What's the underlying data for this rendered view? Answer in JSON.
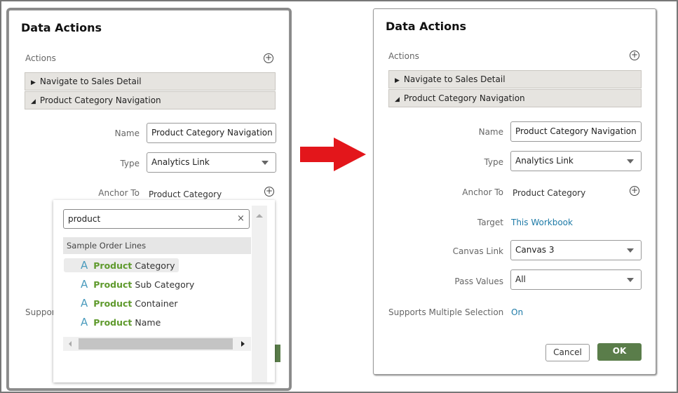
{
  "left": {
    "title": "Data Actions",
    "actions_label": "Actions",
    "accordion": [
      {
        "label": "Navigate to Sales Detail",
        "expanded": false
      },
      {
        "label": "Product Category Navigation",
        "expanded": true
      }
    ],
    "name_label": "Name",
    "name_value": "Product Category Navigation",
    "type_label": "Type",
    "type_value": "Analytics Link",
    "anchor_label": "Anchor To",
    "anchor_value": "Product Category",
    "supports_label_partial": "Suppor",
    "popup": {
      "search_value": "product",
      "group": "Sample Order Lines",
      "items": [
        {
          "match": "Product",
          "rest": " Category",
          "selected": true
        },
        {
          "match": "Product",
          "rest": " Sub Category"
        },
        {
          "match": "Product",
          "rest": " Container"
        },
        {
          "match": "Product",
          "rest": " Name"
        }
      ]
    }
  },
  "right": {
    "title": "Data Actions",
    "actions_label": "Actions",
    "accordion": [
      {
        "label": "Navigate to Sales Detail",
        "expanded": false
      },
      {
        "label": "Product Category Navigation",
        "expanded": true
      }
    ],
    "name_label": "Name",
    "name_value": "Product Category Navigation",
    "type_label": "Type",
    "type_value": "Analytics Link",
    "anchor_label": "Anchor To",
    "anchor_value": "Product Category",
    "target_label": "Target",
    "target_value": "This Workbook",
    "canvas_label": "Canvas Link",
    "canvas_value": "Canvas 3",
    "pass_label": "Pass Values",
    "pass_value": "All",
    "supports_label": "Supports Multiple Selection",
    "supports_value": "On",
    "cancel": "Cancel",
    "ok": "OK"
  },
  "colors": {
    "ok": "#5a7d4a",
    "link": "#1d7aa7",
    "arrow": "#e3161b",
    "highlight": "#5f9a2d"
  }
}
